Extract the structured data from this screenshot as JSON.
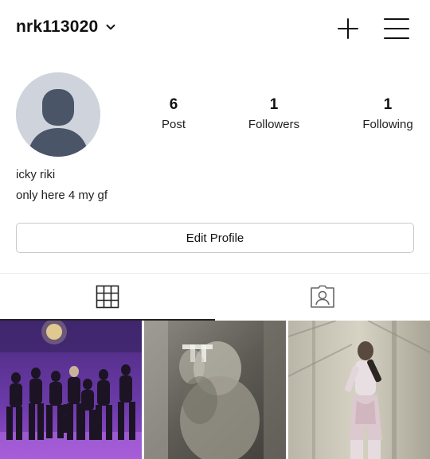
{
  "header": {
    "username": "nrk113020",
    "dropdown_icon": "chevron-down-icon",
    "new_post_icon": "plus-icon",
    "menu_icon": "hamburger-menu-icon"
  },
  "profile": {
    "avatar_icon": "default-avatar-icon",
    "stats": {
      "posts_count": "6",
      "posts_label": "Post",
      "followers_count": "1",
      "followers_label": "Followers",
      "following_count": "1",
      "following_label": "Following"
    },
    "name": "icky riki",
    "bio": "only here 4 my gf",
    "edit_button_label": "Edit Profile"
  },
  "tabs": [
    {
      "name": "posts-grid",
      "icon": "grid-icon",
      "active": true
    },
    {
      "name": "tagged",
      "icon": "tagged-person-icon",
      "active": false
    }
  ],
  "grid_posts": [
    {
      "description": "group-dance-photo"
    },
    {
      "description": "blurry-mirror-selfie"
    },
    {
      "description": "portrait-photo"
    }
  ],
  "colors": {
    "avatar_bg": "#cfd4dc",
    "avatar_fg": "#4a5568",
    "text": "#111111",
    "border": "#c9c9c9"
  }
}
